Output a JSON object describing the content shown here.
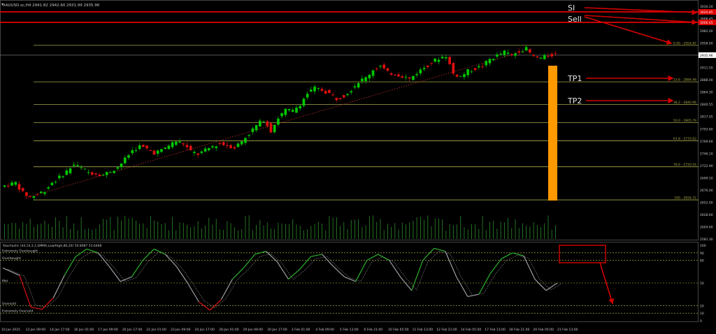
{
  "header": {
    "symbol_line": "XAUUSD.sc,H4  2941.82 2942.60 2931.99 2935.96"
  },
  "colors": {
    "bull": "#00c800",
    "bear": "#e01010",
    "fib": "#a8a84a",
    "sl_line": "#e00000",
    "bar_orange": "#ff9900",
    "arrow": "#d40000",
    "stoch_main": "#9aa0a6",
    "stoch_up": "#2db02d",
    "stoch_down": "#e01010",
    "volume": "#2d8c2d"
  },
  "price_axis": {
    "ticks": [
      "3030.20",
      "3006.45",
      "2982.00",
      "2958.00",
      "2935.96",
      "2911.50",
      "2888.00",
      "2864.30",
      "2840.55",
      "2817.05",
      "2793.60",
      "2769.60",
      "2746.10",
      "2722.90",
      "2699.10",
      "2676.00",
      "2652.00",
      "2628.60",
      "2604.60",
      "2581.30"
    ],
    "current_price": "2935.96",
    "sl_price_a": "3020.85",
    "sl_price_b": "3006.45"
  },
  "fib_levels": [
    {
      "label": "0.00 - 2954.87",
      "price": 2954.87
    },
    {
      "label": "23.6 - 2884.46",
      "price": 2884.46
    },
    {
      "label": "38.2 - 2840.96",
      "price": 2840.96
    },
    {
      "label": "50.0 - 2805.79",
      "price": 2805.79
    },
    {
      "label": "61.8 - 2770.62",
      "price": 2770.62
    },
    {
      "label": "78.6 - 2720.54",
      "price": 2720.54
    },
    {
      "label": "100 - 2656.72",
      "price": 2656.72
    }
  ],
  "annotations": {
    "sl": "SI",
    "sell": "Sell",
    "tp1": "TP1",
    "tp2": "TP2"
  },
  "stochastic": {
    "header": "Stochastic (44,14,3,1,SMMA,Low/High,80,20) 50.8087 53.6468",
    "labels": {
      "extremely_overbought": "Extremely Overbought",
      "overbought": "Overbought",
      "mid": "Mid",
      "oversold": "Oversold",
      "extremely_oversold": "Extremely Oversold"
    },
    "axis_ticks": [
      "100",
      "90",
      "80",
      "50",
      "20",
      "10",
      "0"
    ]
  },
  "time_axis": [
    "10 Jan 2025",
    "13 Jan 09:00",
    "14 Jan 17:00",
    "16 Jan 01:00",
    "17 Jan 09:00",
    "20 Jan 17:00",
    "22 Jan 01:00",
    "23 Jan 09:00",
    "24 Jan 17:00",
    "28 Jan 01:00",
    "29 Jan 09:00",
    "30 Jan 17:00",
    "3 Feb 01:00",
    "4 Feb 09:00",
    "5 Feb 13:00",
    "6 Feb 21:00",
    "10 Feb 05:00",
    "11 Feb 13:00",
    "12 Feb 21:00",
    "14 Feb 05:00",
    "17 Feb 13:00",
    "18 Feb 21:00",
    "20 Feb 05:00",
    "21 Feb 13:00"
  ],
  "chart_data": {
    "type": "candlestick",
    "symbol": "XAUUSD.sc",
    "timeframe": "H4",
    "ylim": [
      2581.3,
      3030.2
    ],
    "price_path": [
      [
        0,
        2682
      ],
      [
        4,
        2690
      ],
      [
        6,
        2670
      ],
      [
        8,
        2662
      ],
      [
        10,
        2668
      ],
      [
        12,
        2675
      ],
      [
        14,
        2690
      ],
      [
        16,
        2700
      ],
      [
        18,
        2712
      ],
      [
        20,
        2725
      ],
      [
        22,
        2718
      ],
      [
        24,
        2710
      ],
      [
        26,
        2708
      ],
      [
        28,
        2705
      ],
      [
        30,
        2712
      ],
      [
        32,
        2720
      ],
      [
        34,
        2735
      ],
      [
        36,
        2752
      ],
      [
        38,
        2760
      ],
      [
        40,
        2755
      ],
      [
        42,
        2748
      ],
      [
        44,
        2752
      ],
      [
        46,
        2762
      ],
      [
        48,
        2770
      ],
      [
        50,
        2765
      ],
      [
        52,
        2750
      ],
      [
        54,
        2745
      ],
      [
        56,
        2752
      ],
      [
        58,
        2760
      ],
      [
        60,
        2765
      ],
      [
        62,
        2762
      ],
      [
        64,
        2758
      ],
      [
        66,
        2770
      ],
      [
        68,
        2785
      ],
      [
        70,
        2800
      ],
      [
        72,
        2812
      ],
      [
        74,
        2790
      ],
      [
        76,
        2815
      ],
      [
        78,
        2830
      ],
      [
        80,
        2828
      ],
      [
        82,
        2842
      ],
      [
        84,
        2862
      ],
      [
        86,
        2872
      ],
      [
        88,
        2868
      ],
      [
        90,
        2862
      ],
      [
        92,
        2852
      ],
      [
        94,
        2858
      ],
      [
        96,
        2870
      ],
      [
        98,
        2885
      ],
      [
        100,
        2892
      ],
      [
        102,
        2908
      ],
      [
        104,
        2915
      ],
      [
        106,
        2902
      ],
      [
        108,
        2900
      ],
      [
        110,
        2896
      ],
      [
        112,
        2890
      ],
      [
        114,
        2902
      ],
      [
        116,
        2912
      ],
      [
        118,
        2922
      ],
      [
        120,
        2930
      ],
      [
        122,
        2935
      ],
      [
        124,
        2900
      ],
      [
        126,
        2895
      ],
      [
        128,
        2905
      ],
      [
        130,
        2910
      ],
      [
        132,
        2915
      ],
      [
        134,
        2928
      ],
      [
        136,
        2935
      ],
      [
        138,
        2942
      ],
      [
        140,
        2935
      ],
      [
        142,
        2945
      ],
      [
        144,
        2948
      ],
      [
        146,
        2932
      ],
      [
        148,
        2930
      ],
      [
        150,
        2935
      ],
      [
        152,
        2938
      ]
    ],
    "stoch_path": [
      [
        0,
        70
      ],
      [
        6,
        60
      ],
      [
        10,
        18
      ],
      [
        14,
        15
      ],
      [
        18,
        30
      ],
      [
        22,
        60
      ],
      [
        26,
        85
      ],
      [
        30,
        95
      ],
      [
        34,
        90
      ],
      [
        38,
        72
      ],
      [
        42,
        52
      ],
      [
        46,
        58
      ],
      [
        50,
        80
      ],
      [
        54,
        95
      ],
      [
        58,
        88
      ],
      [
        62,
        72
      ],
      [
        66,
        50
      ],
      [
        70,
        25
      ],
      [
        74,
        14
      ],
      [
        78,
        28
      ],
      [
        82,
        55
      ],
      [
        86,
        70
      ],
      [
        90,
        88
      ],
      [
        94,
        92
      ],
      [
        98,
        78
      ],
      [
        102,
        55
      ],
      [
        106,
        68
      ],
      [
        110,
        85
      ],
      [
        114,
        88
      ],
      [
        118,
        72
      ],
      [
        122,
        58
      ],
      [
        126,
        52
      ],
      [
        130,
        80
      ],
      [
        134,
        88
      ],
      [
        138,
        80
      ],
      [
        142,
        58
      ],
      [
        146,
        40
      ],
      [
        150,
        80
      ],
      [
        154,
        96
      ],
      [
        158,
        92
      ],
      [
        162,
        58
      ],
      [
        166,
        32
      ],
      [
        170,
        35
      ],
      [
        174,
        62
      ],
      [
        178,
        82
      ],
      [
        182,
        90
      ],
      [
        186,
        86
      ],
      [
        190,
        55
      ],
      [
        194,
        40
      ],
      [
        198,
        50
      ]
    ]
  }
}
